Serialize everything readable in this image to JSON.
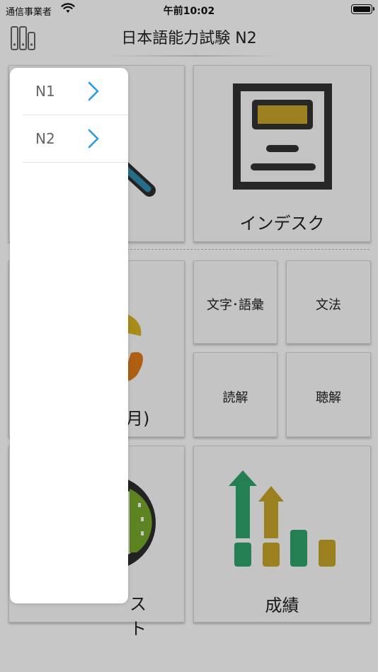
{
  "status_bar": {
    "carrier": "通信事業者",
    "time": "午前10:02"
  },
  "nav": {
    "title": "日本語能力試験 N2",
    "icon": "books-icon"
  },
  "tiles": {
    "index_label": "インデスク",
    "moji_goi_label": "文字･語彙",
    "bunpou_label": "文法",
    "dokkai_label": "読解",
    "choukai_label": "聴解",
    "seiseki_label": "成績",
    "partial_left_label": "月)",
    "partial_test_label": "スト"
  },
  "dropdown": {
    "items": [
      {
        "label": "N1"
      },
      {
        "label": "N2"
      }
    ]
  },
  "colors": {
    "accent_blue": "#2a9be3",
    "gold": "#c7a52a",
    "green": "#2fa36b",
    "dark": "#333333"
  }
}
